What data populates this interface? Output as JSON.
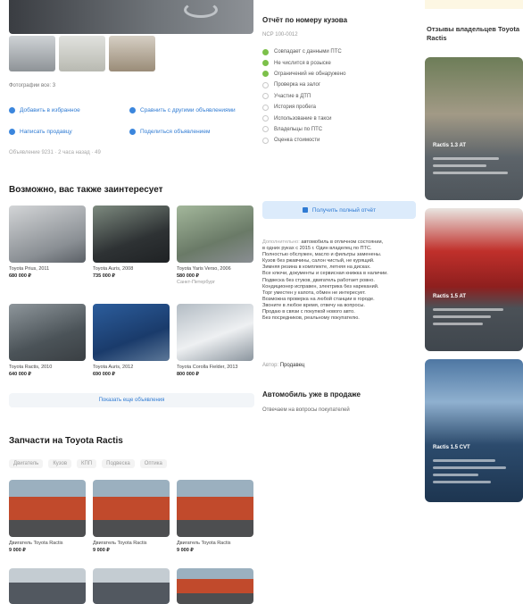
{
  "gallery": {
    "photos_note": "Фотографии все: 3"
  },
  "actions": {
    "favorites": "Добавить в избранное",
    "compare": "Сравнить с другими объявлениями",
    "contact": "Написать продавцу",
    "share": "Поделиться объявлением"
  },
  "listing_meta": "Объявление 9231 · 2 часа назад · 49",
  "similar": {
    "title": "Возможно, вас также заинтересует",
    "cards": [
      {
        "name": "Toyota Prius, 2011",
        "price": "680 000 ₽",
        "sub": ""
      },
      {
        "name": "Toyota Auris, 2008",
        "price": "735 000 ₽",
        "sub": ""
      },
      {
        "name": "Toyota Yaris Verso, 2006",
        "price": "580 000 ₽",
        "sub": "Санкт-Петербург"
      },
      {
        "name": "Toyota Ractis, 2010",
        "price": "640 000 ₽",
        "sub": ""
      },
      {
        "name": "Toyota Auris, 2012",
        "price": "690 000 ₽",
        "sub": ""
      },
      {
        "name": "Toyota Corolla Fielder, 2013",
        "price": "800 000 ₽",
        "sub": ""
      }
    ],
    "more_button": "Показать еще объявления"
  },
  "parts": {
    "title": "Запчасти на Toyota Ractis",
    "chips": [
      "Двигатель",
      "Кузов",
      "КПП",
      "Подвеска",
      "Оптика"
    ],
    "cards": [
      {
        "name": "Двигатель Toyota Ractis",
        "price": "9 000 ₽"
      },
      {
        "name": "Двигатель Toyota Ractis",
        "price": "9 000 ₽"
      },
      {
        "name": "Двигатель Toyota Ractis",
        "price": "9 000 ₽"
      }
    ]
  },
  "report": {
    "title": "Отчёт по номеру кузова",
    "subtitle": "NCP 100-0012",
    "items": [
      {
        "text": "Совпадает с данными ПТС",
        "status": "ok"
      },
      {
        "text": "Не числится в розыске",
        "status": "ok"
      },
      {
        "text": "Ограничений не обнаружено",
        "status": "ok"
      },
      {
        "text": "Проверка на залог",
        "status": "none"
      },
      {
        "text": "Участие в ДТП",
        "status": "none"
      },
      {
        "text": "История пробега",
        "status": "none"
      },
      {
        "text": "Использование в такси",
        "status": "none"
      },
      {
        "text": "Владельцы по ПТС",
        "status": "none"
      },
      {
        "text": "Оценка стоимости",
        "status": "none"
      }
    ],
    "button": "Получить полный отчёт"
  },
  "description": {
    "lines": [
      {
        "muted": "Дополнительно:",
        "text": " автомобиль в отличном состоянии,"
      },
      {
        "muted": "",
        "text": "в одних руках с 2015 г. Один владелец по ПТС."
      },
      {
        "muted": "",
        "text": "Полностью обслужен, масло и фильтры заменены."
      },
      {
        "muted": "",
        "text": "Кузов без ржавчины, салон чистый, не курящий."
      },
      {
        "muted": "",
        "text": "Зимняя резина в комплекте, летняя на дисках."
      },
      {
        "muted": "",
        "text": "Все ключи, документы и сервисная книжка в наличии."
      },
      {
        "muted": "",
        "text": "Подвеска без стуков, двигатель работает ровно."
      },
      {
        "muted": "",
        "text": "Кондиционер исправен, электрика без нареканий."
      },
      {
        "muted": "",
        "text": "Торг уместен у капота, обмен не интересует."
      },
      {
        "muted": "",
        "text": "Возможна проверка на любой станции в городе."
      },
      {
        "muted": "",
        "text": "Звоните в любое время, отвечу на вопросы."
      },
      {
        "muted": "",
        "text": "Продаю в связи с покупкой нового авто."
      },
      {
        "muted": "",
        "text": "Без посредников, реальному покупателю."
      }
    ]
  },
  "author": {
    "label": "Автор:",
    "name": "Продавец"
  },
  "qa": {
    "title": "Автомобиль уже в продаже",
    "subtitle": "Отвечаем на вопросы покупателей"
  },
  "sidebar": {
    "title": "Отзывы владельцев Toyota Ractis",
    "promos": [
      {
        "label": "Ractis 1.3 AT"
      },
      {
        "label": "Ractis 1.5 AT"
      },
      {
        "label": "Ractis 1.5 CVT"
      }
    ]
  }
}
